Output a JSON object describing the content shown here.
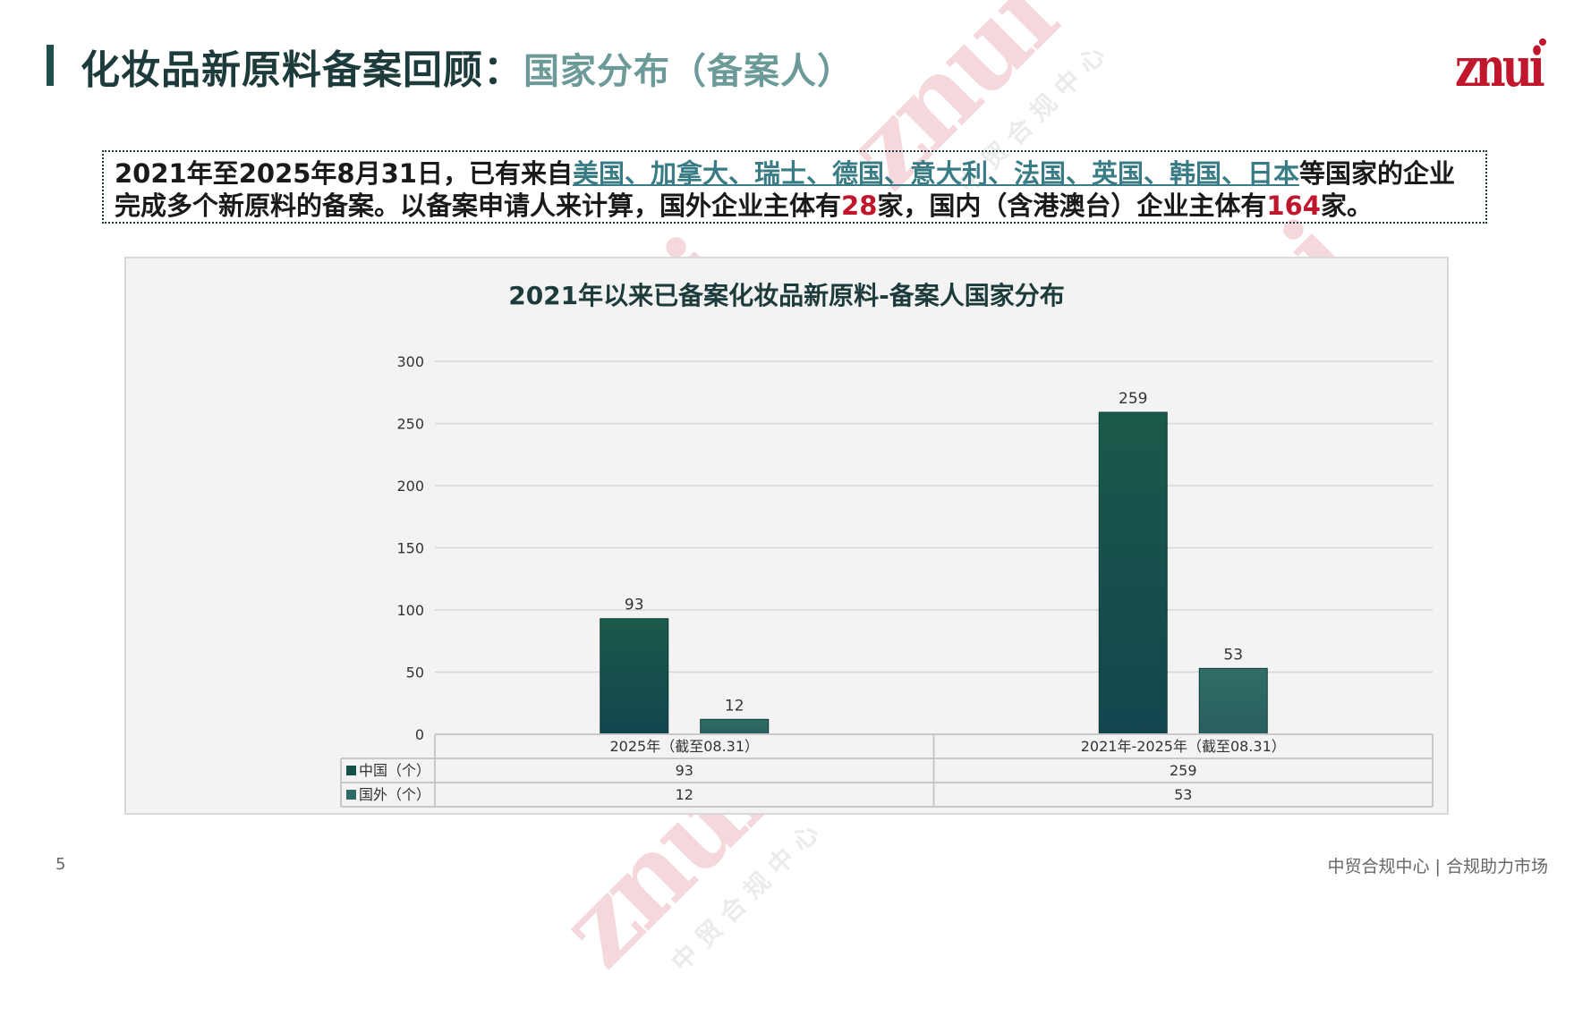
{
  "header": {
    "title_main": "化妆品新原料备案回顾：",
    "title_sub": "国家分布（备案人）",
    "logo_text": "znui"
  },
  "summary": {
    "part1": "2021年至2025年8月31日，已有来自",
    "countries": "美国、加拿大、瑞士、德国、意大利、法国、英国、韩国、日本",
    "part2": "等国家的企业",
    "part3": "完成多个新原料的备案。以备案申请人来计算，国外企业主体有",
    "foreign_count": "28",
    "part4": "家，国内（含港澳台）企业主体有",
    "domestic_count": "164",
    "part5": "家。"
  },
  "watermark": {
    "logo": "znui",
    "text": "中贸合规中心"
  },
  "colors": {
    "china": "#16504a",
    "foreign": "#2f6b66",
    "title": "#1d3b3a",
    "highlight": "#3a7c86",
    "number": "#c0172d"
  },
  "chart_data": {
    "type": "bar",
    "title": "2021年以来已备案化妆品新原料-备案人国家分布",
    "categories": [
      "2025年（截至08.31）",
      "2021年-2025年（截至08.31）"
    ],
    "series": [
      {
        "name": "中国（个）",
        "values": [
          93,
          259
        ]
      },
      {
        "name": "国外（个）",
        "values": [
          12,
          53
        ]
      }
    ],
    "ylim": [
      0,
      300
    ],
    "yticks": [
      0,
      50,
      100,
      150,
      200,
      250,
      300
    ],
    "grid": true,
    "legend": "data-table"
  },
  "footer": {
    "page_number": "5",
    "text": "中贸合规中心 | 合规助力市场"
  }
}
